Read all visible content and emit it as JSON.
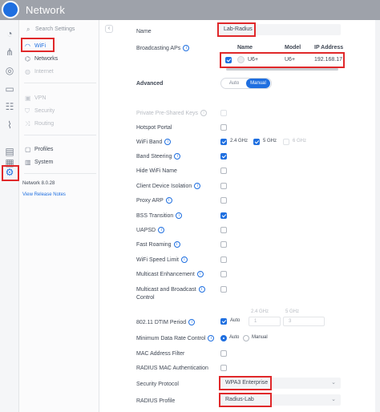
{
  "app": {
    "title": "Network"
  },
  "rail_icons": [
    "dashboard-icon",
    "topology-icon",
    "devices-icon",
    "clients-icon",
    "apps-icon",
    "insights-icon",
    "logs-icon",
    "notes-icon",
    "settings-icon"
  ],
  "settings_nav": {
    "search_placeholder": "Search Settings",
    "items": [
      {
        "label": "WiFi",
        "icon": "wifi-icon",
        "state": "active"
      },
      {
        "label": "Networks",
        "icon": "networks-icon",
        "state": "normal"
      },
      {
        "label": "Internet",
        "icon": "globe-icon",
        "state": "dim"
      },
      {
        "label": "VPN",
        "icon": "vpn-icon",
        "state": "dim"
      },
      {
        "label": "Security",
        "icon": "shield-icon",
        "state": "dim"
      },
      {
        "label": "Routing",
        "icon": "routing-icon",
        "state": "dim"
      },
      {
        "label": "Profiles",
        "icon": "profiles-icon",
        "state": "normal"
      },
      {
        "label": "System",
        "icon": "system-icon",
        "state": "normal"
      }
    ],
    "version": "Network 8.0.28",
    "release_notes": "View Release Notes"
  },
  "form": {
    "name_label": "Name",
    "name_value": "Lab-Radius",
    "ap_label": "Broadcasting APs",
    "ap_table": {
      "headers": [
        "Name",
        "Model",
        "IP Address"
      ],
      "row": {
        "name": "U6+",
        "model": "U6+",
        "ip": "192.168.17"
      }
    },
    "advanced_label": "Advanced",
    "advanced_options": [
      "Auto",
      "Manual"
    ],
    "advanced_selected": "Manual",
    "rows": [
      {
        "label": "Private Pre-Shared Keys",
        "info": true,
        "checked": false,
        "dim": true
      },
      {
        "label": "Hotspot Portal",
        "info": false,
        "checked": false,
        "dim": false
      },
      {
        "label": "WiFi Band",
        "info": true,
        "checked": null,
        "dim": false
      },
      {
        "label": "Band Steering",
        "info": true,
        "checked": true,
        "dim": false
      },
      {
        "label": "Hide WiFi Name",
        "info": false,
        "checked": false,
        "dim": false
      },
      {
        "label": "Client Device Isolation",
        "info": true,
        "checked": false,
        "dim": false
      },
      {
        "label": "Proxy ARP",
        "info": true,
        "checked": false,
        "dim": false
      },
      {
        "label": "BSS Transition",
        "info": true,
        "checked": true,
        "dim": false
      },
      {
        "label": "UAPSD",
        "info": true,
        "checked": false,
        "dim": false
      },
      {
        "label": "Fast Roaming",
        "info": true,
        "checked": false,
        "dim": false
      },
      {
        "label": "WiFi Speed Limit",
        "info": true,
        "checked": false,
        "dim": false
      },
      {
        "label": "Multicast Enhancement",
        "info": true,
        "checked": false,
        "dim": false
      },
      {
        "label": "Multicast and Broadcast",
        "label2": "Control",
        "info": true,
        "checked": false,
        "dim": false
      }
    ],
    "bands": [
      {
        "label": "2.4 GHz",
        "checked": true
      },
      {
        "label": "5 GHz",
        "checked": true
      },
      {
        "label": "6 GHz",
        "checked": false
      }
    ],
    "dtim": {
      "label": "802.11 DTIM Period",
      "auto_label": "Auto",
      "auto_checked": true,
      "col_24": "2.4 GHz",
      "col_5": "5 GHz",
      "val_24": "1",
      "val_5": "3"
    },
    "min_rate": {
      "label": "Minimum Data Rate Control",
      "options": [
        "Auto",
        "Manual"
      ],
      "selected": "Auto"
    },
    "mac_filter": {
      "label": "MAC Address Filter"
    },
    "radius_mac": {
      "label": "RADIUS MAC Authentication"
    },
    "security_protocol": {
      "label": "Security Protocol",
      "value": "WPA3 Enterprise"
    },
    "radius_profile": {
      "label": "RADIUS Profile",
      "value": "Radius-Lab"
    }
  },
  "colors": {
    "accent": "#1f6fe0",
    "highlight": "#e0282a",
    "topbar": "#9ea2aa"
  }
}
